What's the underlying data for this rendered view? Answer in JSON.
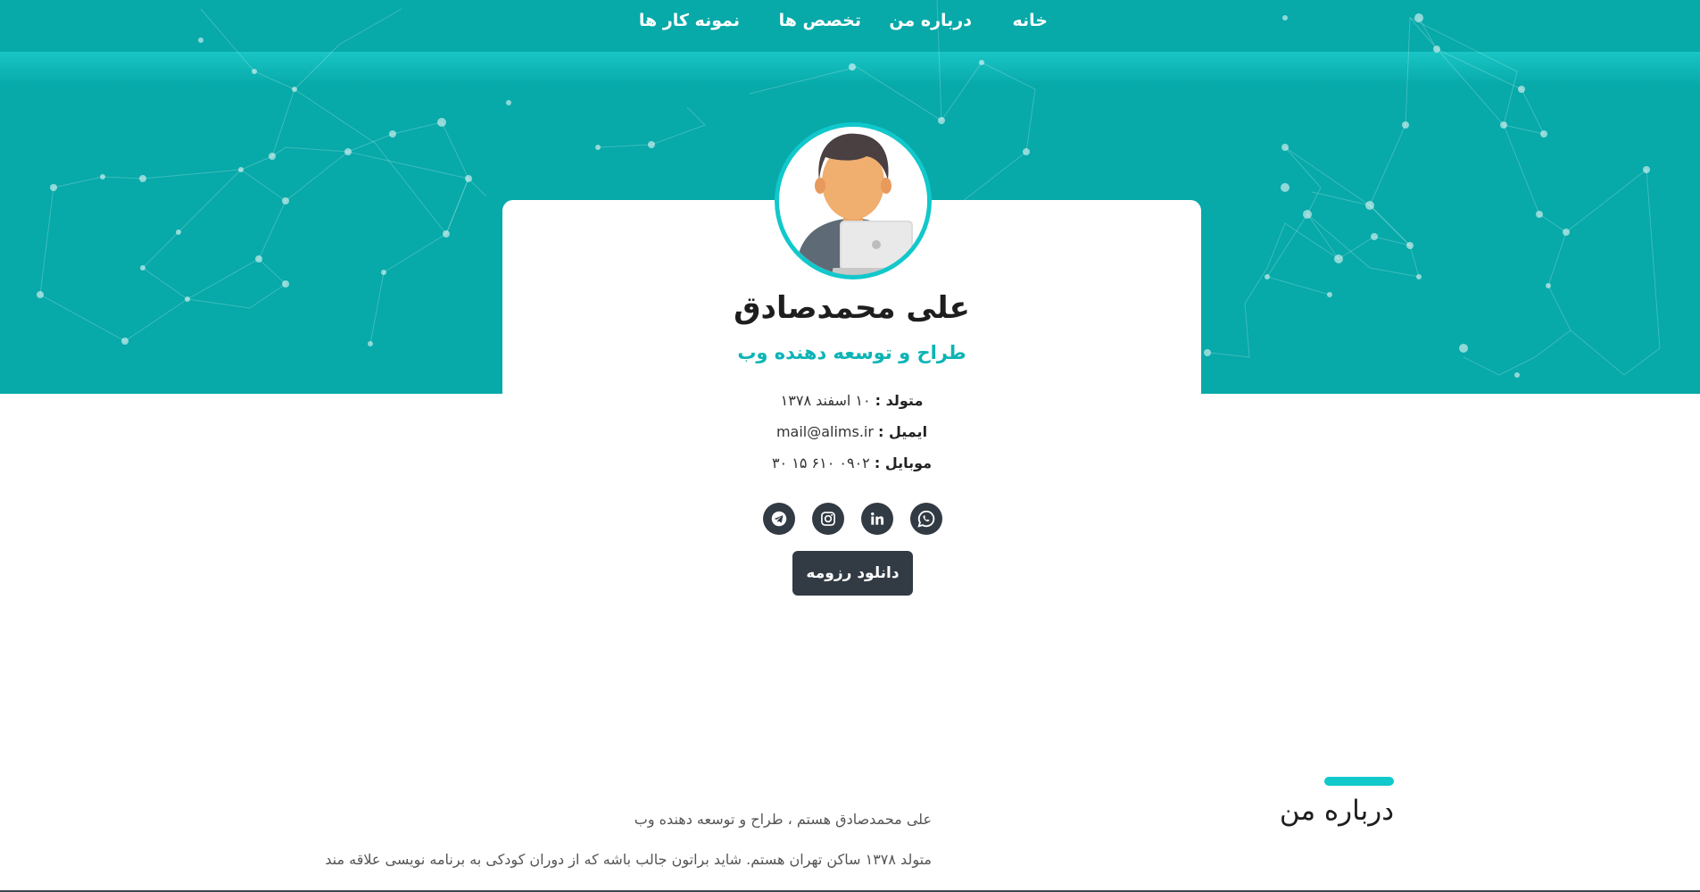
{
  "nav": {
    "items": [
      {
        "label": "خانه"
      },
      {
        "label": "درباره من"
      },
      {
        "label": "تخصص ها"
      },
      {
        "label": "نمونه کار ها"
      }
    ]
  },
  "profile": {
    "name": "علی محمدصادق",
    "role": "طراح و توسعه دهنده وب",
    "birth_label": "متولد :",
    "birth_value": "۱۰ اسفند ۱۳۷۸",
    "email_label": "ایمیل :",
    "email_value": "mail@alims.ir",
    "mobile_label": "موبایل :",
    "mobile_value": "۰۹۰۲ ۶۱۰ ۱۵ ۳۰",
    "resume_button": "دانلود رزومه"
  },
  "socials": [
    "whatsapp-icon",
    "linkedin-icon",
    "instagram-icon",
    "telegram-icon"
  ],
  "about": {
    "title": "درباره من",
    "paragraph1": "علی محمدصادق هستم ، طراح و توسعه دهنده وب",
    "paragraph2": "متولد ۱۳۷۸ ساکن تهران هستم. شاید براتون جالب باشه که از دوران کودکی به برنامه نویسی علاقه مند"
  },
  "colors": {
    "hero": "#07a9a9",
    "accent": "#11c8cb",
    "dark": "#323a44"
  }
}
